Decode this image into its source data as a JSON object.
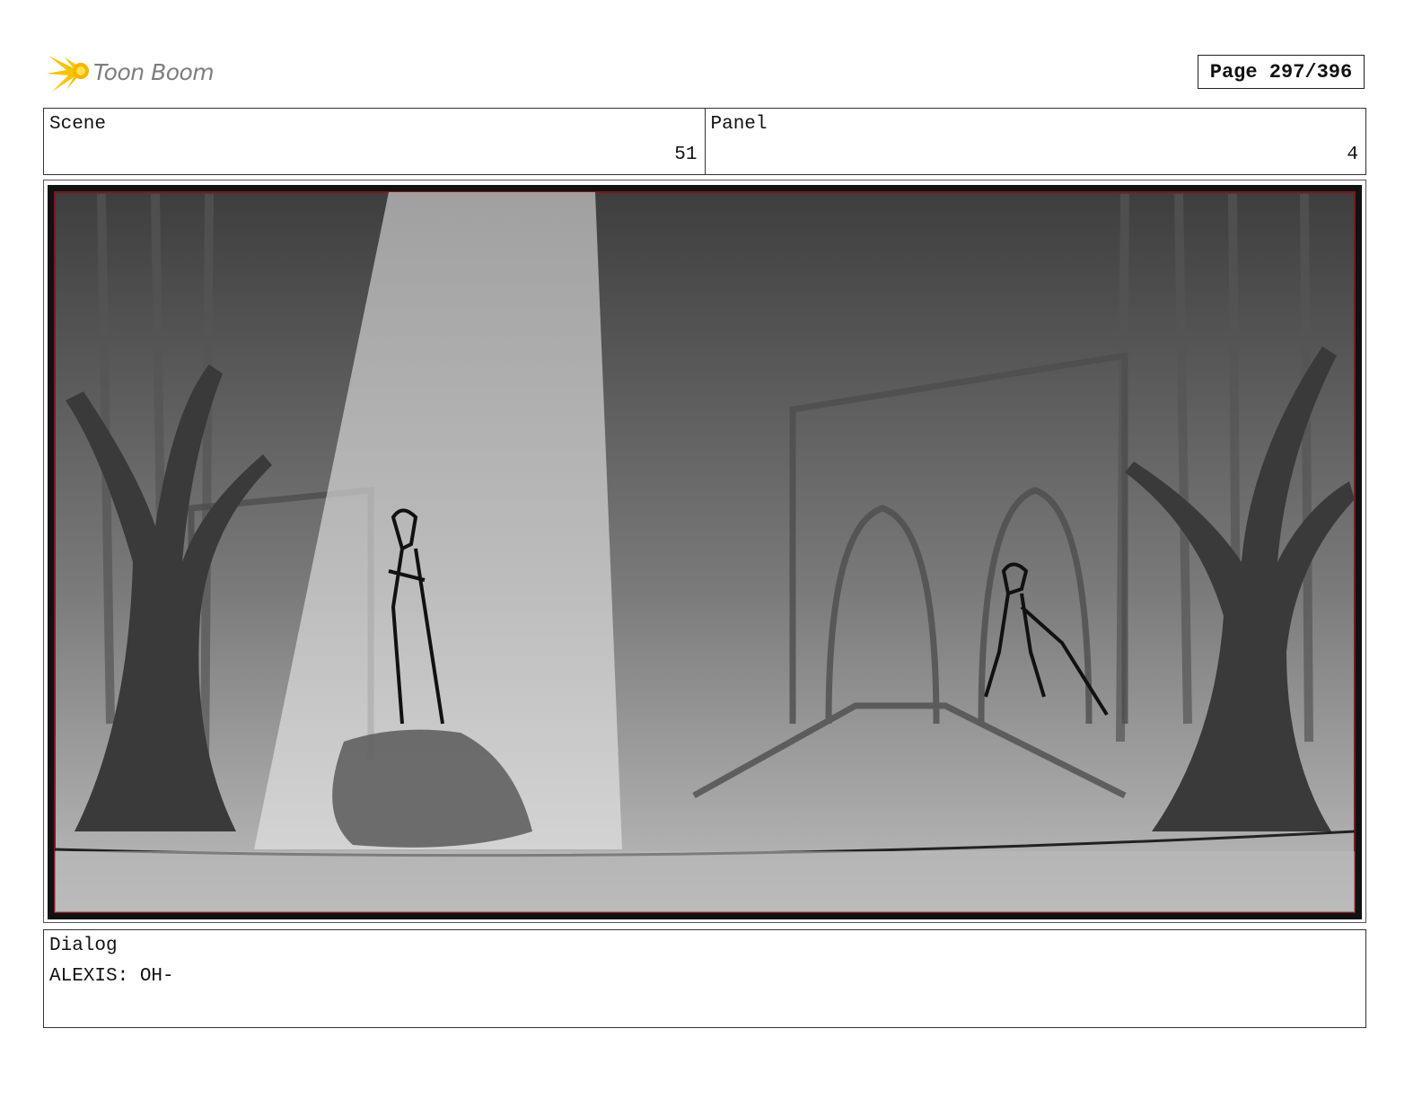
{
  "header": {
    "brand": "Toon Boom",
    "page_label": "Page 297/396"
  },
  "scene": {
    "label": "Scene",
    "value": "51"
  },
  "panel": {
    "label": "Panel",
    "value": "4"
  },
  "dialog": {
    "label": "Dialog",
    "text": "ALEXIS: OH-"
  },
  "colors": {
    "logo_yellow": "#f5c400",
    "frame_red": "#7a1b1b",
    "logo_gray": "#7d7d7d"
  }
}
